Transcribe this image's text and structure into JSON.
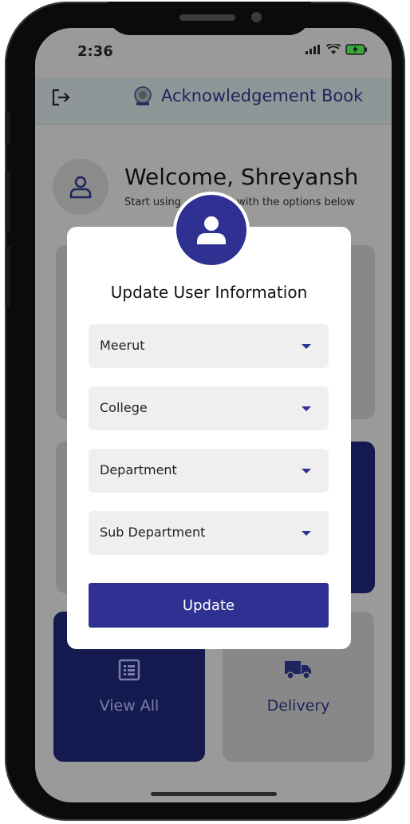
{
  "status_bar": {
    "time": "2:36"
  },
  "app_bar": {
    "logout_icon": "logout-icon",
    "logo_icon": "crest-logo",
    "title": "Acknowledgement Book"
  },
  "welcome": {
    "title": "Welcome, Shreyansh",
    "subtitle_left": "Start using",
    "subtitle_right": "with the options below"
  },
  "cards": [
    {
      "label": "View All",
      "icon": "list-icon"
    },
    {
      "label": "Delivery",
      "icon": "truck-icon"
    }
  ],
  "modal": {
    "avatar_icon": "user-icon",
    "title": "Update User Information",
    "dropdowns": [
      {
        "value": "Meerut"
      },
      {
        "value": "College"
      },
      {
        "value": "Department"
      },
      {
        "value": "Sub Department"
      }
    ],
    "update_label": "Update"
  },
  "colors": {
    "primary": "#2f3192",
    "navy_card": "#141a4f",
    "overlay_gray": "#9a9a9a",
    "title_navy": "#1e245c"
  }
}
